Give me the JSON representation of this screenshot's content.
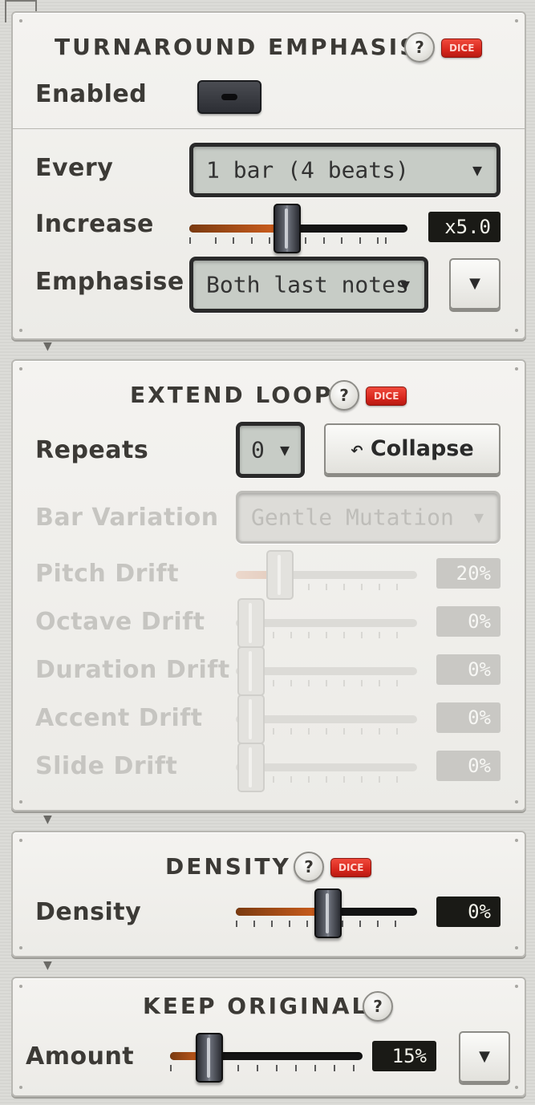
{
  "turnaround": {
    "title": "TURNAROUND EMPHASIS",
    "help": "?",
    "dice": "DICE",
    "enabled_label": "Enabled",
    "every_label": "Every",
    "every_value": "1 bar (4 beats)",
    "increase_label": "Increase",
    "increase_value": "x5.0",
    "emphasise_label": "Emphasise",
    "emphasise_value": "Both last notes"
  },
  "extend_loop": {
    "title": "EXTEND LOOP",
    "help": "?",
    "dice": "DICE",
    "repeats_label": "Repeats",
    "repeats_value": "0",
    "collapse_label": "Collapse",
    "bar_variation_label": "Bar Variation",
    "bar_variation_value": "Gentle Mutation",
    "pitch_drift_label": "Pitch Drift",
    "pitch_drift_value": "20%",
    "octave_drift_label": "Octave Drift",
    "octave_drift_value": "0%",
    "duration_drift_label": "Duration Drift",
    "duration_drift_value": "0%",
    "accent_drift_label": "Accent Drift",
    "accent_drift_value": "0%",
    "slide_drift_label": "Slide Drift",
    "slide_drift_value": "0%"
  },
  "density": {
    "title": "DENSITY",
    "help": "?",
    "dice": "DICE",
    "density_label": "Density",
    "density_value": "0%"
  },
  "keep_original": {
    "title": "KEEP ORIGINAL",
    "help": "?",
    "amount_label": "Amount",
    "amount_value": "15%"
  },
  "glyphs": {
    "dropdown_arrow": "▼",
    "undo_arrow": "↶"
  }
}
